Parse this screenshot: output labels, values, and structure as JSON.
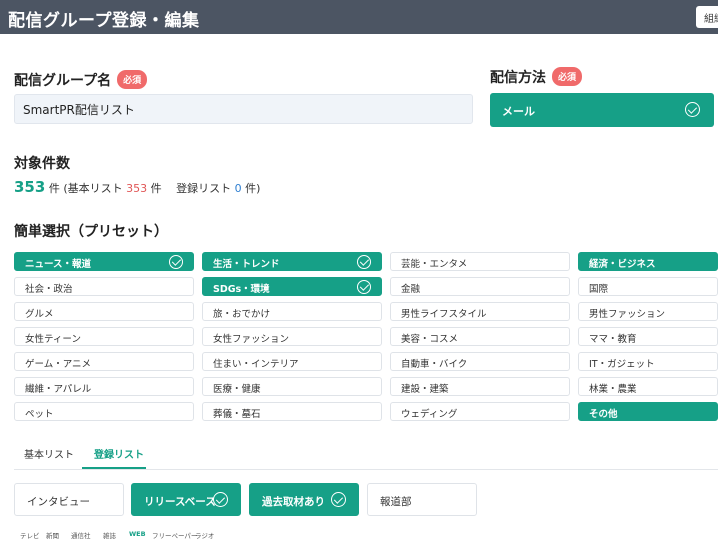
{
  "header": {
    "title": "配信グループ登録・編集",
    "button_label": "組織"
  },
  "group_name": {
    "label": "配信グループ名",
    "required": "必須",
    "value": "SmartPR配信リスト"
  },
  "method": {
    "label": "配信方法",
    "required": "必須",
    "selected": "メール"
  },
  "target": {
    "label": "対象件数",
    "total": "353",
    "unit": "件",
    "breakdown_prefix": "(基本リスト",
    "basic_count": "353",
    "mid_text": "件　 登録リスト",
    "registered_count": "0",
    "suffix": "件)"
  },
  "presets": {
    "label": "簡単選択（プリセット）",
    "items": [
      {
        "label": "ニュース・報道",
        "selected": true
      },
      {
        "label": "生活・トレンド",
        "selected": true
      },
      {
        "label": "芸能・エンタメ",
        "selected": false
      },
      {
        "label": "経済・ビジネス",
        "selected": true
      },
      {
        "label": "社会・政治",
        "selected": false
      },
      {
        "label": "SDGs・環境",
        "selected": true
      },
      {
        "label": "金融",
        "selected": false
      },
      {
        "label": "国際",
        "selected": false
      },
      {
        "label": "グルメ",
        "selected": false
      },
      {
        "label": "旅・おでかけ",
        "selected": false
      },
      {
        "label": "男性ライフスタイル",
        "selected": false
      },
      {
        "label": "男性ファッション",
        "selected": false
      },
      {
        "label": "女性ティーン",
        "selected": false
      },
      {
        "label": "女性ファッション",
        "selected": false
      },
      {
        "label": "美容・コスメ",
        "selected": false
      },
      {
        "label": "ママ・教育",
        "selected": false
      },
      {
        "label": "ゲーム・アニメ",
        "selected": false
      },
      {
        "label": "住まい・インテリア",
        "selected": false
      },
      {
        "label": "自動車・バイク",
        "selected": false
      },
      {
        "label": "IT・ガジェット",
        "selected": false
      },
      {
        "label": "繊維・アパレル",
        "selected": false
      },
      {
        "label": "医療・健康",
        "selected": false
      },
      {
        "label": "建設・建築",
        "selected": false
      },
      {
        "label": "林業・農業",
        "selected": false
      },
      {
        "label": "ペット",
        "selected": false
      },
      {
        "label": "葬儀・墓石",
        "selected": false
      },
      {
        "label": "ウェディング",
        "selected": false
      },
      {
        "label": "その他",
        "selected": true
      }
    ]
  },
  "list_tabs": [
    {
      "label": "基本リスト",
      "active": false
    },
    {
      "label": "登録リスト",
      "active": true
    }
  ],
  "categories": [
    {
      "label": "インタビュー",
      "selected": false
    },
    {
      "label": "リリースベース",
      "selected": true
    },
    {
      "label": "過去取材あり",
      "selected": true
    },
    {
      "label": "報道部",
      "selected": false
    }
  ],
  "media_tabs": [
    {
      "label": "テレビ",
      "active": false
    },
    {
      "label": "新聞",
      "active": false
    },
    {
      "label": "通信社",
      "active": false
    },
    {
      "label": "雑誌",
      "active": false
    },
    {
      "label": "WEB",
      "active": true
    },
    {
      "label": "フリーペーパー",
      "active": false
    },
    {
      "label": "ラジオ",
      "active": false
    }
  ],
  "icons": {
    "selected": "check-circle-icon"
  },
  "colors": {
    "accent": "#16a087",
    "header": "#4c5563",
    "required": "#f06a6a",
    "basic_count": "#e05656",
    "registered_count": "#2f7fd1"
  }
}
